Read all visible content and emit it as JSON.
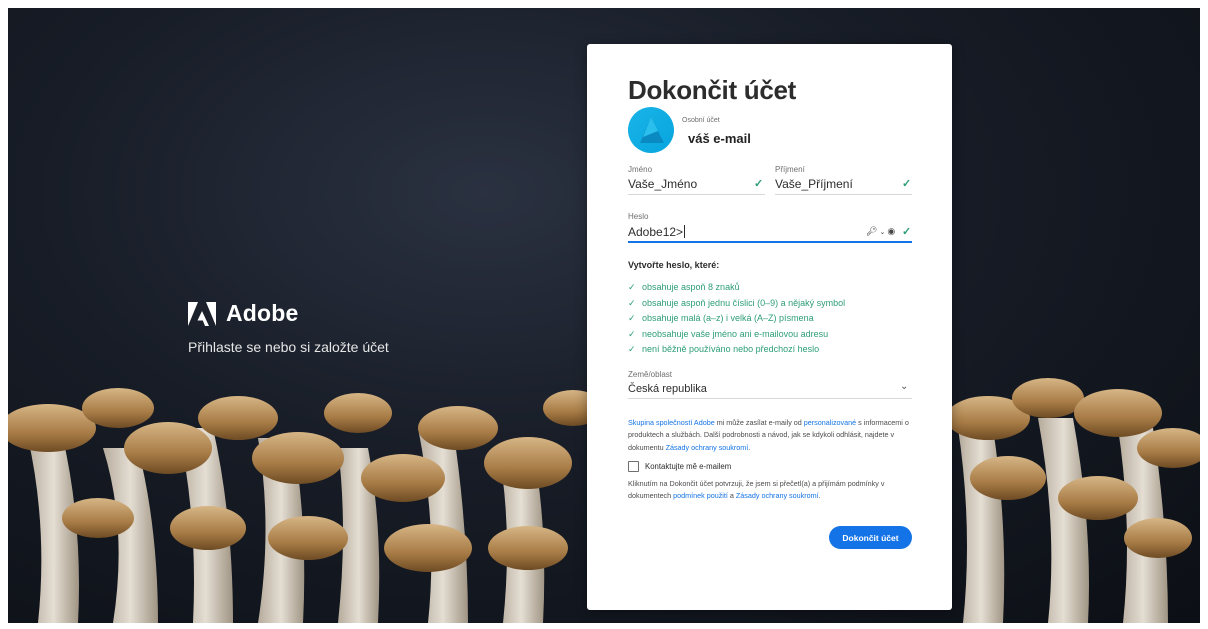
{
  "brand": {
    "name": "Adobe",
    "tagline": "Přihlaste se nebo si založte účet"
  },
  "card": {
    "title": "Dokončit účet",
    "account": {
      "type_label": "Osobní účet",
      "email": "váš e-mail"
    },
    "first_name": {
      "label": "Jméno",
      "value": "Vaše_Jméno"
    },
    "last_name": {
      "label": "Příjmení",
      "value": "Vaše_Příjmení"
    },
    "password": {
      "label": "Heslo",
      "value": "Adobe12>"
    },
    "requirements": {
      "title": "Vytvořte heslo, které:",
      "items": [
        "obsahuje aspoň 8 znaků",
        "obsahuje aspoň jednu číslici (0–9) a nějaký symbol",
        "obsahuje malá (a–z) i velká (A–Z) písmena",
        "neobsahuje vaše jméno ani e-mailovou adresu",
        "není běžně používáno nebo předchozí heslo"
      ]
    },
    "country": {
      "label": "Země/oblast",
      "value": "Česká republika"
    },
    "consent": {
      "link1": "Skupina společností Adobe",
      "text1": " mi může zasílat e-maily od ",
      "link2": "personalizované",
      "text2": " s informacemi o produktech a službách. Další podrobnosti a návod, jak se kdykoli odhlásit, najdete v dokumentu ",
      "link3": "Zásady ochrany soukromí",
      "text3": "."
    },
    "contact_checkbox_label": "Kontaktujte mě e-mailem",
    "terms": {
      "text1": "Kliknutím na Dokončit účet potvrzuji, že jsem si přečetl(a) a přijímám podmínky v dokumentech ",
      "link1": "podmínek použití",
      "text2": " a ",
      "link2": "Zásady ochrany soukromí",
      "text3": "."
    },
    "submit_label": "Dokončit účet"
  },
  "colors": {
    "accent": "#1473e6",
    "valid": "#2d9d78",
    "avatar": "#0fb0e6"
  }
}
